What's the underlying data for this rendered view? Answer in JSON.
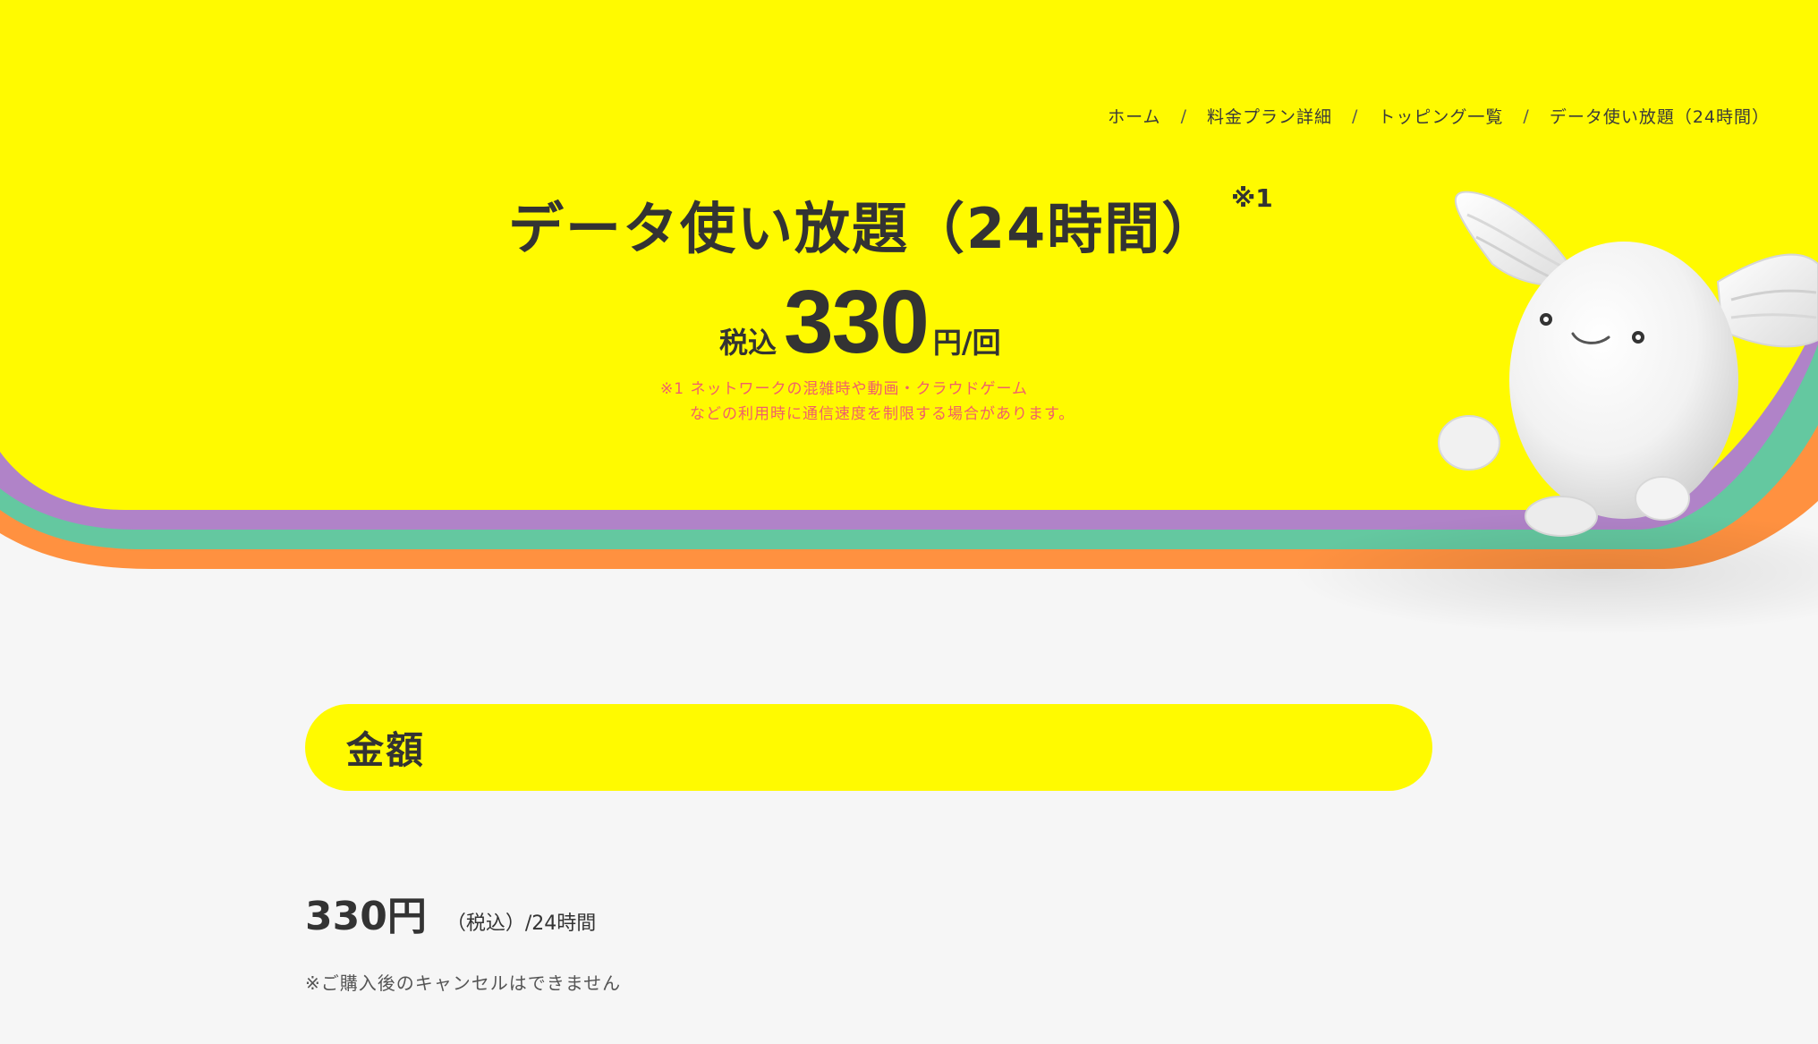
{
  "breadcrumb": {
    "items": [
      "ホーム",
      "料金プラン詳細",
      "トッピング一覧",
      "データ使い放題（24時間）"
    ],
    "separator": "/"
  },
  "hero": {
    "title": "データ使い放題（24時間）",
    "note_mark": "※1",
    "price_prefix": "税込",
    "price_number": "330",
    "price_suffix": "円/回",
    "note_line1": "※1 ネットワークの混雑時や動画・クラウドゲーム",
    "note_line2": "などの利用時に通信速度を制限する場合があります。"
  },
  "section": {
    "title": "金額"
  },
  "amount": {
    "main": "330円",
    "sub": "（税込）/24時間",
    "cancel_note": "※ご購入後のキャンセルはできません"
  },
  "colors": {
    "brand_yellow": "#fffa00",
    "stripe_purple": "#b083c8",
    "stripe_green": "#64c8a0",
    "stripe_orange": "#ff9140",
    "background": "#f6f6f6",
    "text": "#333333",
    "note_red": "#f0606a"
  },
  "icons": {
    "mascot": "winged-egg-mascot-icon"
  }
}
